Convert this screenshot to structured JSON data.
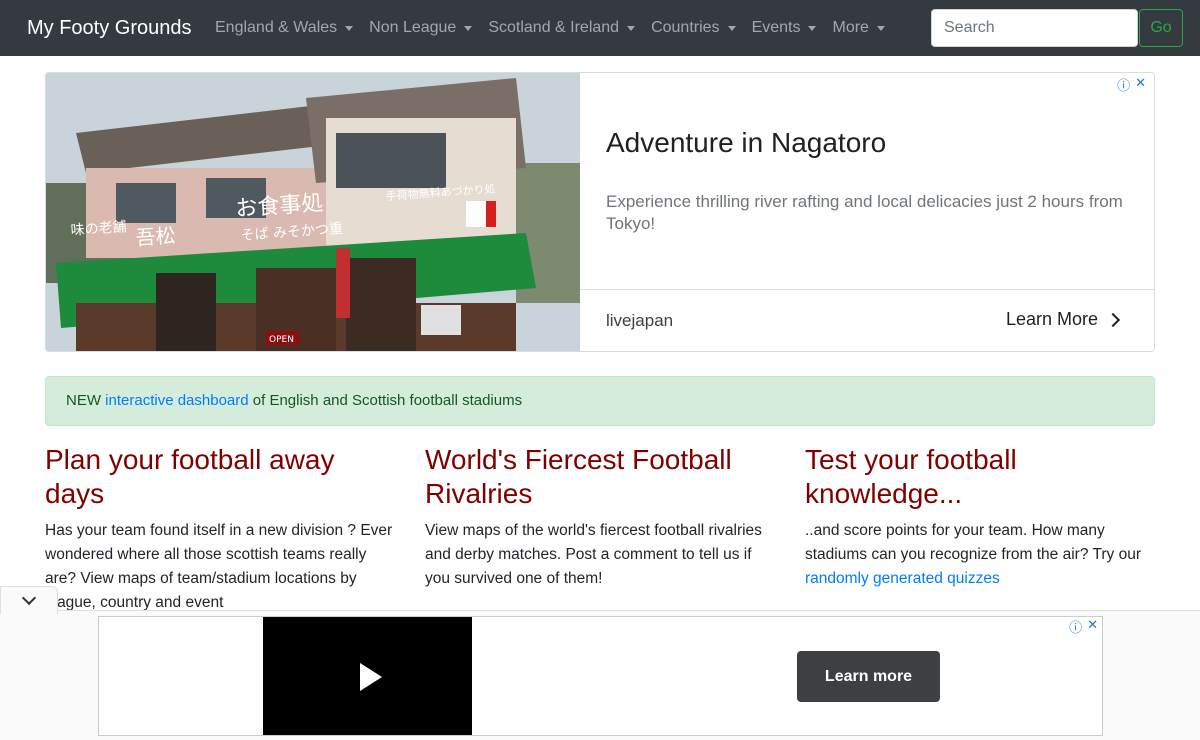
{
  "navbar": {
    "brand": "My Footy Grounds",
    "items": [
      {
        "label": "England & Wales"
      },
      {
        "label": "Non League"
      },
      {
        "label": "Scotland & Ireland"
      },
      {
        "label": "Countries"
      },
      {
        "label": "Events"
      },
      {
        "label": "More"
      }
    ],
    "search_placeholder": "Search",
    "go_label": "Go"
  },
  "ad_top": {
    "choices_info": "ⓘ",
    "choices_close": "✕",
    "headline": "Adventure in Nagatoro",
    "body": "Experience thrilling river rafting and local delicacies just 2 hours from Tokyo!",
    "source": "livejapan",
    "cta": "Learn More",
    "sign_main": "お食事処",
    "sign_side": "味の老舗",
    "sign_name": "吾松",
    "sign_menu": "そば みそかつ重",
    "sign_right": "手荷物無料あづかり処",
    "sign_open": "OPEN",
    "colors": {
      "sign_green": "#1e8a3c"
    }
  },
  "alert": {
    "prefix": "NEW ",
    "link": "interactive dashboard",
    "suffix": " of English and Scottish football stadiums"
  },
  "columns": [
    {
      "title": "Plan your football away days",
      "text": "Has your team found itself in a new division ? Ever wondered where all those scottish teams really are? View maps of team/stadium locations by league, country and event"
    },
    {
      "title": "World's Fiercest Football Rivalries",
      "text": "View maps of the world's fiercest football rivalries and derby matches. Post a comment to tell us if you survived one of them!"
    },
    {
      "title": "Test your football knowledge...",
      "text": "..and score points for your team. How many stadiums can you recognize from the air? Try our ",
      "link": "randomly generated quizzes"
    }
  ],
  "ad_bottom": {
    "cta": "Learn more",
    "choices_info": "ⓘ",
    "choices_close": "✕"
  },
  "colors": {
    "heading": "#800000",
    "navbar": "#343a40",
    "link": "#007bff"
  }
}
